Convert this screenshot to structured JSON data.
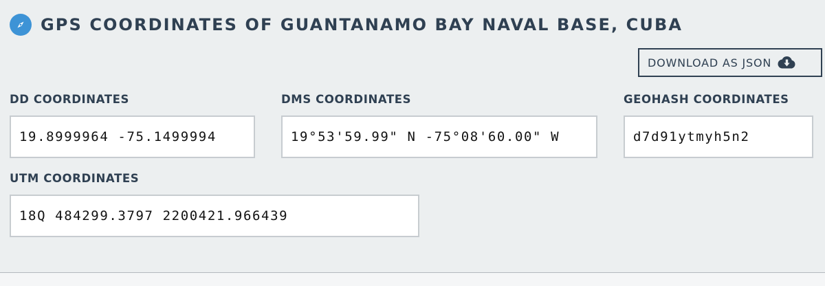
{
  "header": {
    "title": "GPS COORDINATES OF GUANTANAMO BAY NAVAL BASE, CUBA",
    "icon": "compass-icon",
    "icon_color": "#3d93d6"
  },
  "download": {
    "label": "DOWNLOAD AS JSON",
    "icon": "cloud-download-icon"
  },
  "fields": {
    "dd": {
      "label": "DD COORDINATES",
      "value": "19.8999964 -75.1499994"
    },
    "dms": {
      "label": "DMS COORDINATES",
      "value": "19°53'59.99\" N -75°08'60.00\" W"
    },
    "geohash": {
      "label": "GEOHASH COORDINATES",
      "value": "d7d91ytmyh5n2"
    },
    "utm": {
      "label": "UTM COORDINATES",
      "value": "18Q 484299.3797 2200421.966439"
    }
  },
  "colors": {
    "text": "#2f4052",
    "background": "#eceff0",
    "input_border": "#c7ccd0"
  }
}
